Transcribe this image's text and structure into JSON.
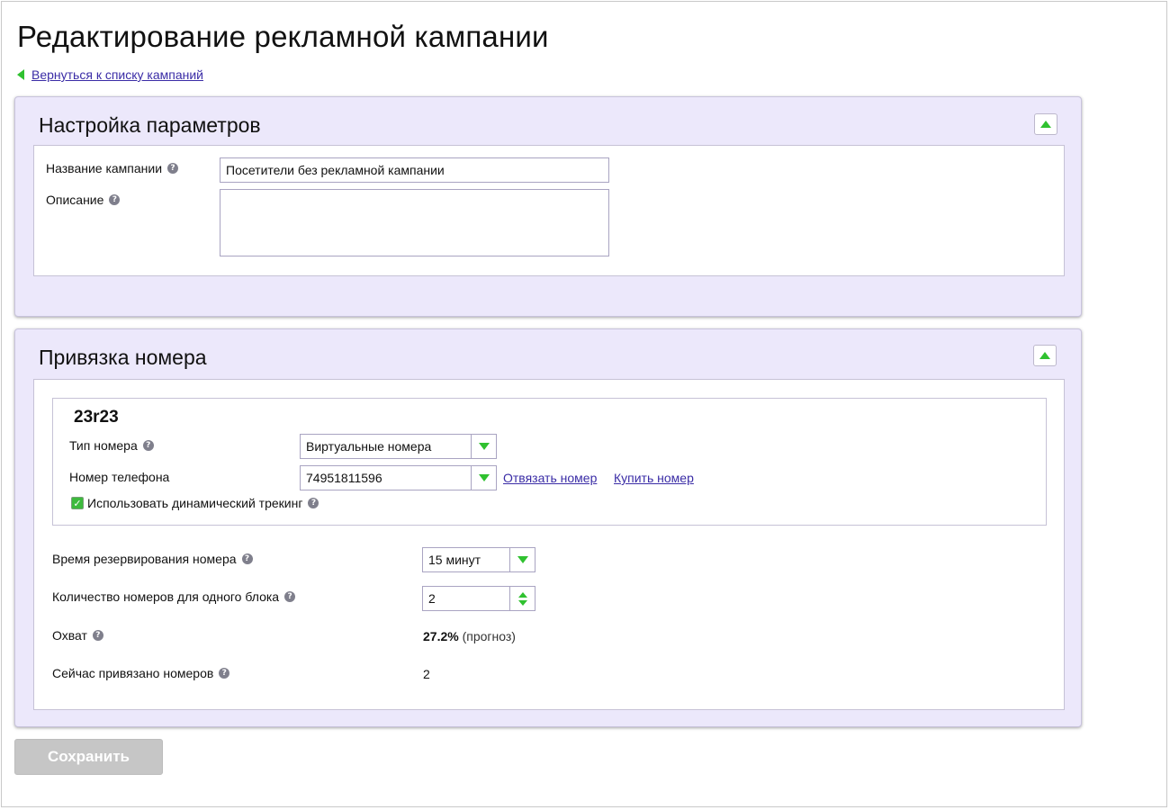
{
  "page": {
    "title": "Редактирование рекламной кампании",
    "back_link": "Вернуться к списку кампаний"
  },
  "settings_panel": {
    "title": "Настройка параметров",
    "campaign_name_label": "Название кампании",
    "campaign_name_value": "Посетители без рекламной кампании",
    "description_label": "Описание",
    "description_value": ""
  },
  "binding_panel": {
    "title": "Привязка номера",
    "number_block": {
      "name": "23r23",
      "number_type_label": "Тип номера",
      "number_type_value": "Виртуальные номера",
      "phone_label": "Номер телефона",
      "phone_value": "74951811596",
      "unbind_link": "Отвязать номер",
      "buy_link": "Купить номер",
      "dynamic_tracking_label": "Использовать динамический трекинг",
      "dynamic_tracking_checked": true
    },
    "reserve_time_label": "Время резервирования номера",
    "reserve_time_value": "15 минут",
    "numbers_per_block_label": "Количество номеров для одного блока",
    "numbers_per_block_value": "2",
    "coverage_label": "Охват",
    "coverage_value": "27.2%",
    "coverage_note": "(прогноз)",
    "bound_count_label": "Сейчас привязано номеров",
    "bound_count_value": "2"
  },
  "actions": {
    "save_label": "Сохранить"
  },
  "colors": {
    "panel_bg": "#ece8fb",
    "accent_green": "#2fc12f",
    "link": "#3a2ca6",
    "disabled_button": "#c6c6c6"
  }
}
